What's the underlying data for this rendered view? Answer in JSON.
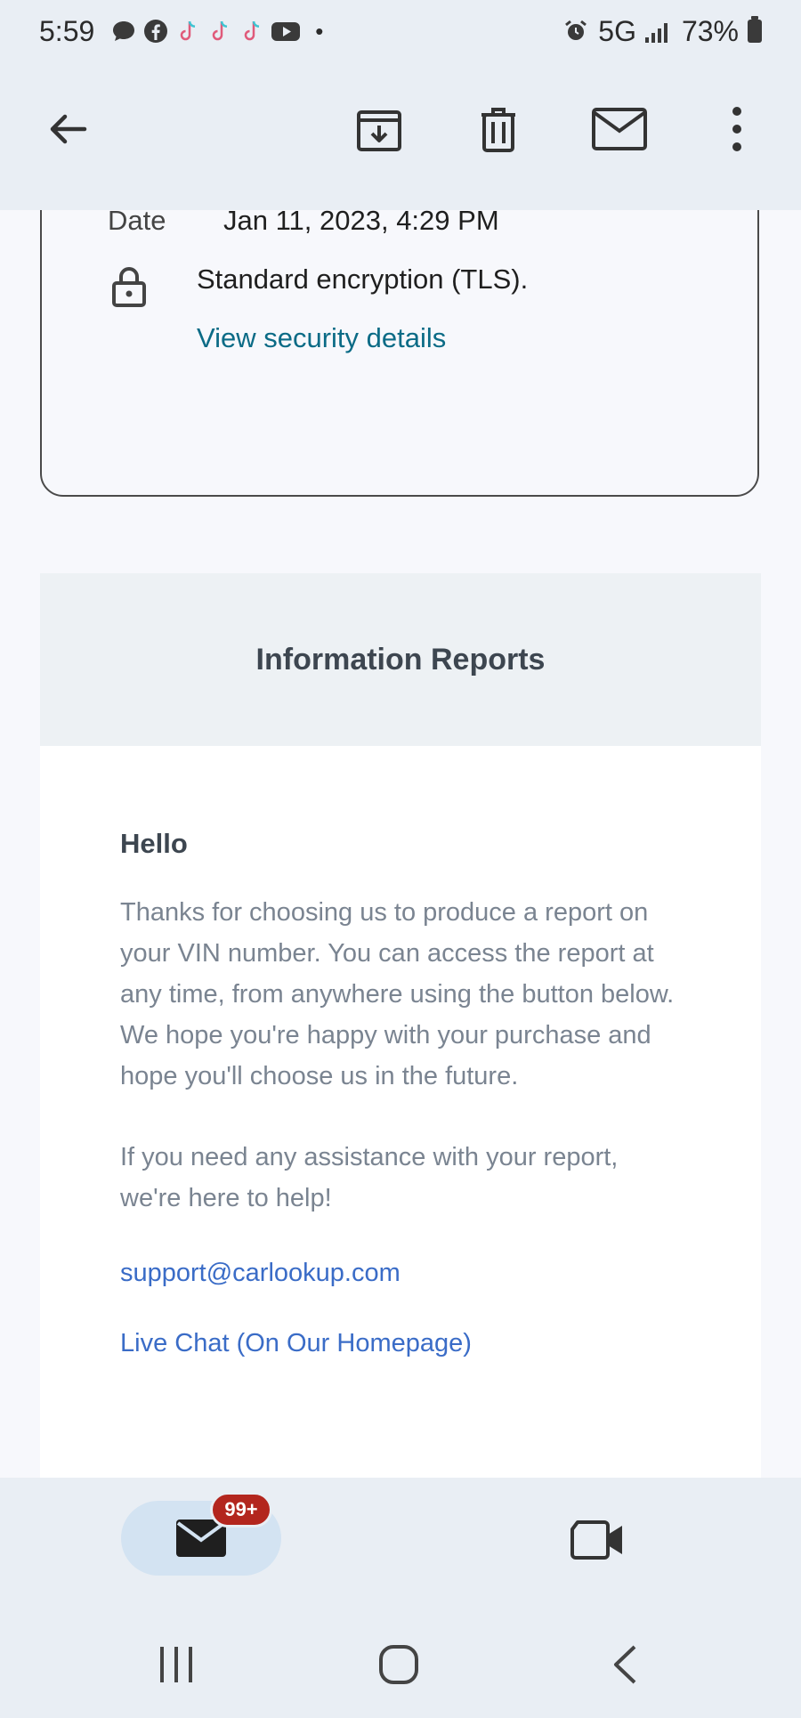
{
  "status_bar": {
    "time": "5:59",
    "network": "5G",
    "battery": "73%",
    "notification_icons": [
      "chat-icon",
      "facebook-icon",
      "tiktok-icon",
      "tiktok-icon",
      "tiktok-icon",
      "youtube-icon"
    ],
    "more_dot": "•"
  },
  "toolbar": {
    "back": "back-arrow-icon",
    "archive": "archive-icon",
    "delete": "trash-icon",
    "mark_unread": "mail-icon",
    "more": "more-vert-icon"
  },
  "details": {
    "date_label": "Date",
    "date_value": "Jan 11, 2023, 4:29 PM",
    "encryption": "Standard encryption (TLS).",
    "security_link": "View security details"
  },
  "email": {
    "header_title": "Information Reports",
    "greeting": "Hello",
    "paragraph1": "Thanks for choosing us to produce a report on your VIN number. You can access the report at any time, from anywhere using the button below. We hope you're happy with your purchase and hope you'll choose us in the future.",
    "paragraph2": "If you need any assistance with your report, we're here to help!",
    "support_email": "support@carlookup.com",
    "live_chat": "Live Chat (On Our Homepage)"
  },
  "bottom_nav": {
    "mail_badge": "99+",
    "items": [
      "mail-icon",
      "video-camera-icon"
    ]
  },
  "system_nav": [
    "recents-icon",
    "home-icon",
    "back-icon"
  ],
  "colors": {
    "link_teal": "#0b6b86",
    "link_blue": "#3a6cc7",
    "badge_red": "#b3261e",
    "bar_bg": "#e9eef4"
  }
}
